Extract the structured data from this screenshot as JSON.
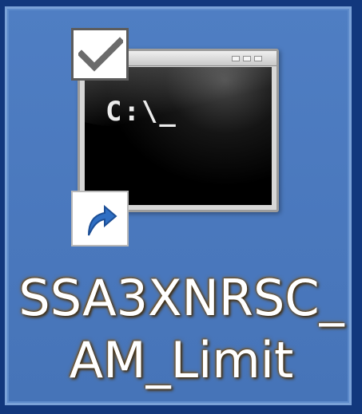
{
  "desktop_icon": {
    "label_line1": "SSA3XNRSC_",
    "label_line2": "AM_Limit",
    "console_prompt": "C:\\_",
    "selected": true,
    "checked": true,
    "is_shortcut": true,
    "icons": {
      "checkbox": "checkmark-icon",
      "console": "command-prompt-icon",
      "shortcut": "shortcut-arrow-icon"
    },
    "colors": {
      "selection": "#4a78bd",
      "selection_border": "#7aa2d8",
      "desktop": "#12387d",
      "shortcut_arrow": "#2f6fc4"
    }
  }
}
